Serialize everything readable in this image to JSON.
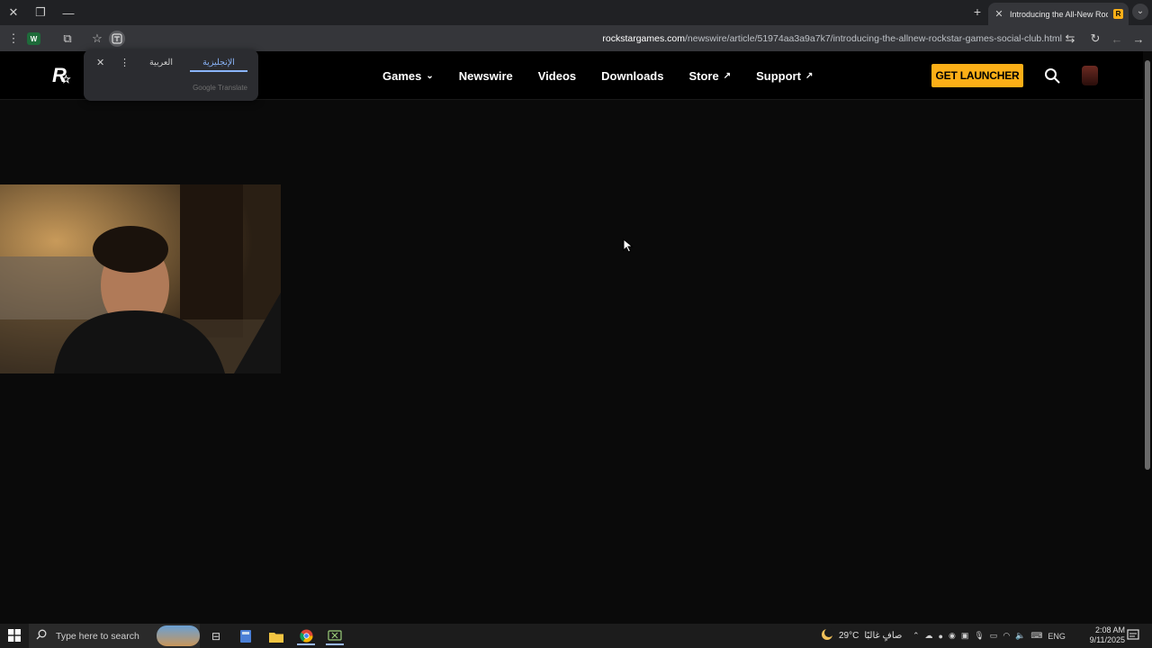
{
  "browser": {
    "tab_title": "Introducing the All-New Rockstar Games Social Club",
    "tab_favicon": "R",
    "url_host": "rockstargames.com",
    "url_path": "/newswire/article/51974aa3a9a7k7/introducing-the-allnew-rockstar-games-social-club.html",
    "extension_badge": "W"
  },
  "translate": {
    "lang_source": "العربية",
    "lang_target": "الإنجليزية",
    "provider": "Google Translate"
  },
  "site": {
    "logo_text": "R",
    "nav": [
      {
        "label": "Games",
        "glyph": "⌄"
      },
      {
        "label": "Newswire",
        "glyph": ""
      },
      {
        "label": "Videos",
        "glyph": ""
      },
      {
        "label": "Downloads",
        "glyph": ""
      },
      {
        "label": "Store",
        "glyph": "↗"
      },
      {
        "label": "Support",
        "glyph": "↗"
      }
    ],
    "launcher_label": "GET LAUNCHER",
    "accent": "#fcaf17"
  },
  "taskbar": {
    "search_placeholder": "Type here to search",
    "weather_temp": "29°C",
    "weather_desc": "صافٍ غالبًا",
    "lang": "ENG",
    "time": "2:08 AM",
    "date": "9/11/2025"
  }
}
